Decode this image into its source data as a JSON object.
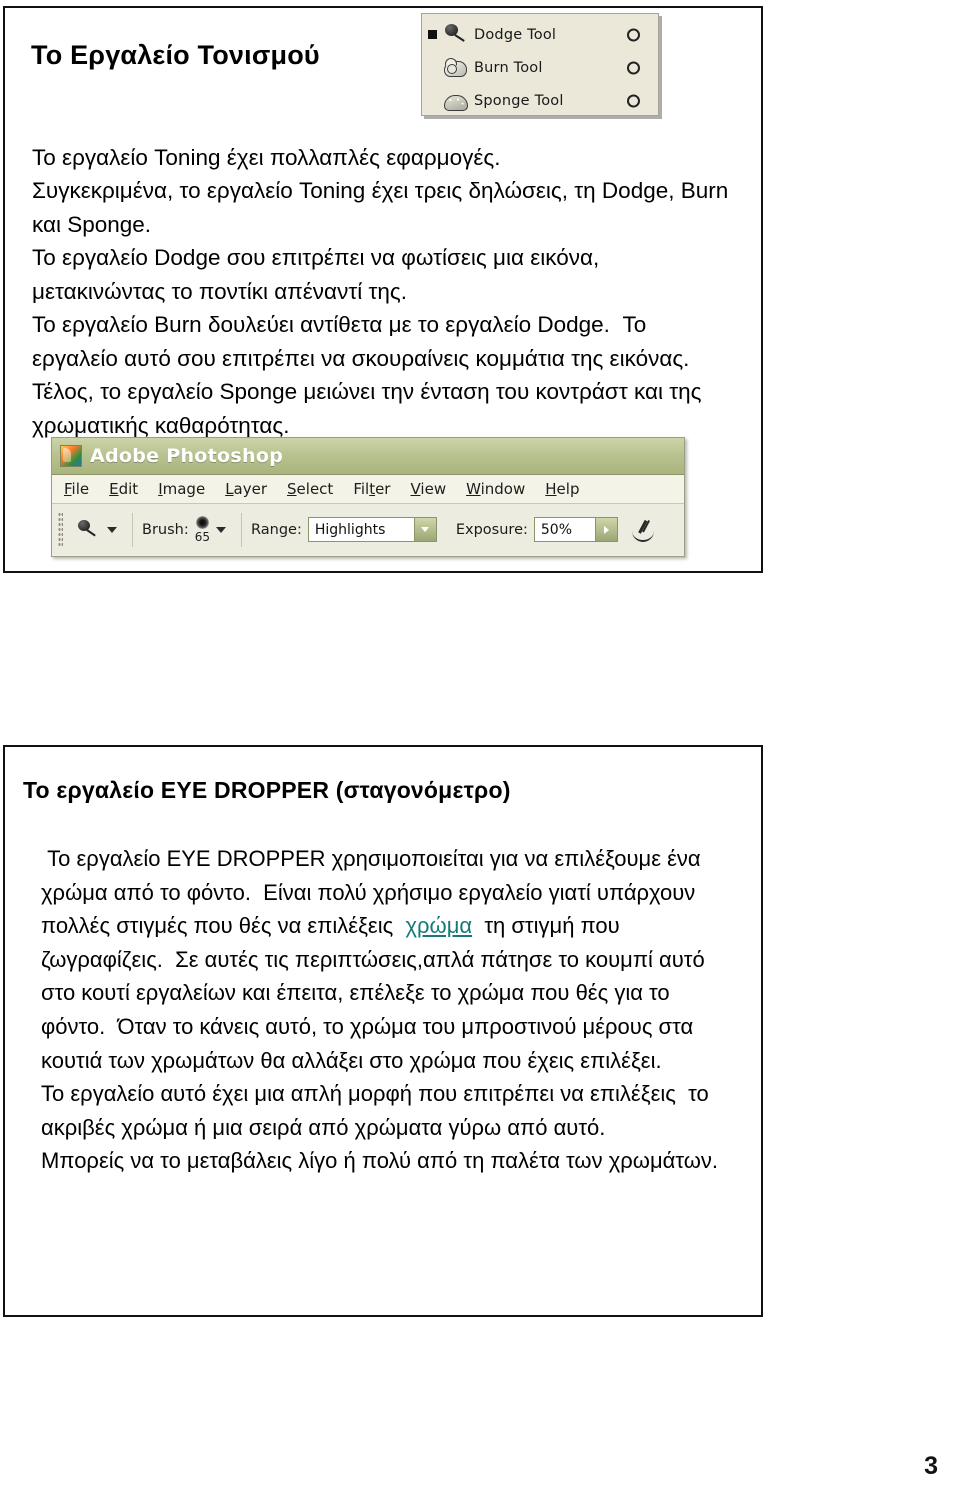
{
  "document": {
    "page_number": "3",
    "link_color": "#157a77"
  },
  "slide1": {
    "heading": "Το Εργαλείο Τονισμού",
    "body": "Το εργαλείο Toning έχει πολλαπλές εφαρμογές.\nΣυγκεκριμένα, το εργαλείο Toning έχει τρεις δηλώσεις, τη Dodge, Burn και Sponge.\nΤο εργαλείο Dodge σου επιτρέπει να φωτίσεις μια εικόνα, μετακινώντας το ποντίκι απέναντί της.\nΤο εργαλείο Burn δουλεύει αντίθετα με το εργαλείο Dodge.  Το εργαλείο αυτό σου επιτρέπει να σκουραίνεις κομμάτια της εικόνας.\nΤέλος, το εργαλείο Sponge μειώνει την ένταση του κοντράστ και της χρωματικής καθαρότητας.",
    "tool_flyout": {
      "background_color": "#ebe8d9",
      "items": [
        {
          "label": "Dodge Tool",
          "icon": "dodge-tool-icon",
          "selected": true
        },
        {
          "label": "Burn Tool",
          "icon": "burn-tool-icon",
          "selected": false
        },
        {
          "label": "Sponge Tool",
          "icon": "sponge-tool-icon",
          "selected": false
        }
      ]
    },
    "photoshop_window": {
      "title": "Adobe Photoshop",
      "titlebar_color": "#b9c391",
      "menus": [
        {
          "pre": "",
          "mnemonic": "F",
          "post": "ile"
        },
        {
          "pre": "",
          "mnemonic": "E",
          "post": "dit"
        },
        {
          "pre": "",
          "mnemonic": "I",
          "post": "mage"
        },
        {
          "pre": "",
          "mnemonic": "L",
          "post": "ayer"
        },
        {
          "pre": "",
          "mnemonic": "S",
          "post": "elect"
        },
        {
          "pre": "Fil",
          "mnemonic": "t",
          "post": "er"
        },
        {
          "pre": "",
          "mnemonic": "V",
          "post": "iew"
        },
        {
          "pre": "",
          "mnemonic": "W",
          "post": "indow"
        },
        {
          "pre": "",
          "mnemonic": "H",
          "post": "elp"
        }
      ],
      "options_bar": {
        "brush_label": "Brush:",
        "brush_size": "65",
        "range_label": "Range:",
        "range_value": "Highlights",
        "exposure_label": "Exposure:",
        "exposure_value": "50%"
      }
    }
  },
  "slide2": {
    "heading": "Το εργαλείο EYE DROPPER (σταγονόμετρο)",
    "body_before_link": " Το εργαλείο EYE DROPPER χρησιμοποιείται για να επιλέξουμε ένα χρώμα από το φόντο.  Είναι πολύ χρήσιμο εργαλείο γιατί υπάρχουν πολλές στιγμές που θές να επιλέξεις  ",
    "link_text": "χρώμα",
    "body_after_link": "  τη στιγμή που ζωγραφίζεις.  Σε αυτές τις περιπτώσεις,απλά πάτησε το κουμπί αυτό στο κουτί εργαλείων και έπειτα, επέλεξε το χρώμα που θές για το φόντο.  Όταν το κάνεις αυτό, το χρώμα του μπροστινού μέρους στα κουτιά των χρωμάτων θα αλλάξει στο χρώμα που έχεις επιλέξει.\nΤο εργαλείο αυτό έχει μια απλή μορφή που επιτρέπει να επιλέξεις  το ακριβές χρώμα ή μια σειρά από χρώματα γύρω από αυτό.\nΜπορείς να το μεταβάλεις λίγο ή πολύ από τη παλέτα των χρωμάτων."
  }
}
